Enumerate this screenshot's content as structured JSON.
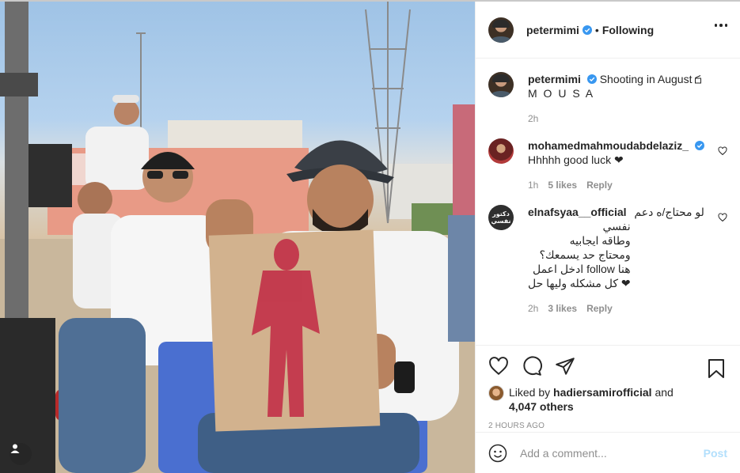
{
  "header": {
    "username": "petermimi",
    "separator": "•",
    "follow_status": "Following"
  },
  "caption": {
    "username": "petermimi",
    "text": "Shooting in August",
    "text_line2": "M O U S A",
    "time": "2h"
  },
  "comments": [
    {
      "username": "mohamedmahmoudabdelaziz_",
      "text": "Hhhhh good luck ❤",
      "time": "1h",
      "likes": "5 likes",
      "reply": "Reply"
    },
    {
      "username": "elnafsyaa__official",
      "avatar_text": "دكتور نفسي",
      "lines": [
        "لو محتاج/ه دعم",
        "نفسي",
        "وطاقه ايجابيه",
        "ومحتاج حد يسمعك؟",
        "هنا follow ادخل اعمل",
        "❤ كل مشكله وليها حل"
      ],
      "time": "2h",
      "likes": "3 likes",
      "reply": "Reply"
    }
  ],
  "likes": {
    "prefix": "Liked by",
    "liker": "hadiersamirofficial",
    "conj": "and",
    "others": "4,047 others"
  },
  "timestamp": "2 HOURS AGO",
  "add_comment": {
    "placeholder": "Add a comment...",
    "post_label": "Post"
  },
  "icons": {
    "like": "heart-icon",
    "comment": "comment-icon",
    "share": "paper-plane-icon",
    "save": "bookmark-icon",
    "more": "more-options-icon",
    "emoji": "emoji-icon",
    "verified": "verified-badge-icon",
    "user_tag": "user-tag-icon"
  },
  "colors": {
    "verified": "#3897f0",
    "post_button": "#b2dffc",
    "muted": "#8e8e8e"
  }
}
